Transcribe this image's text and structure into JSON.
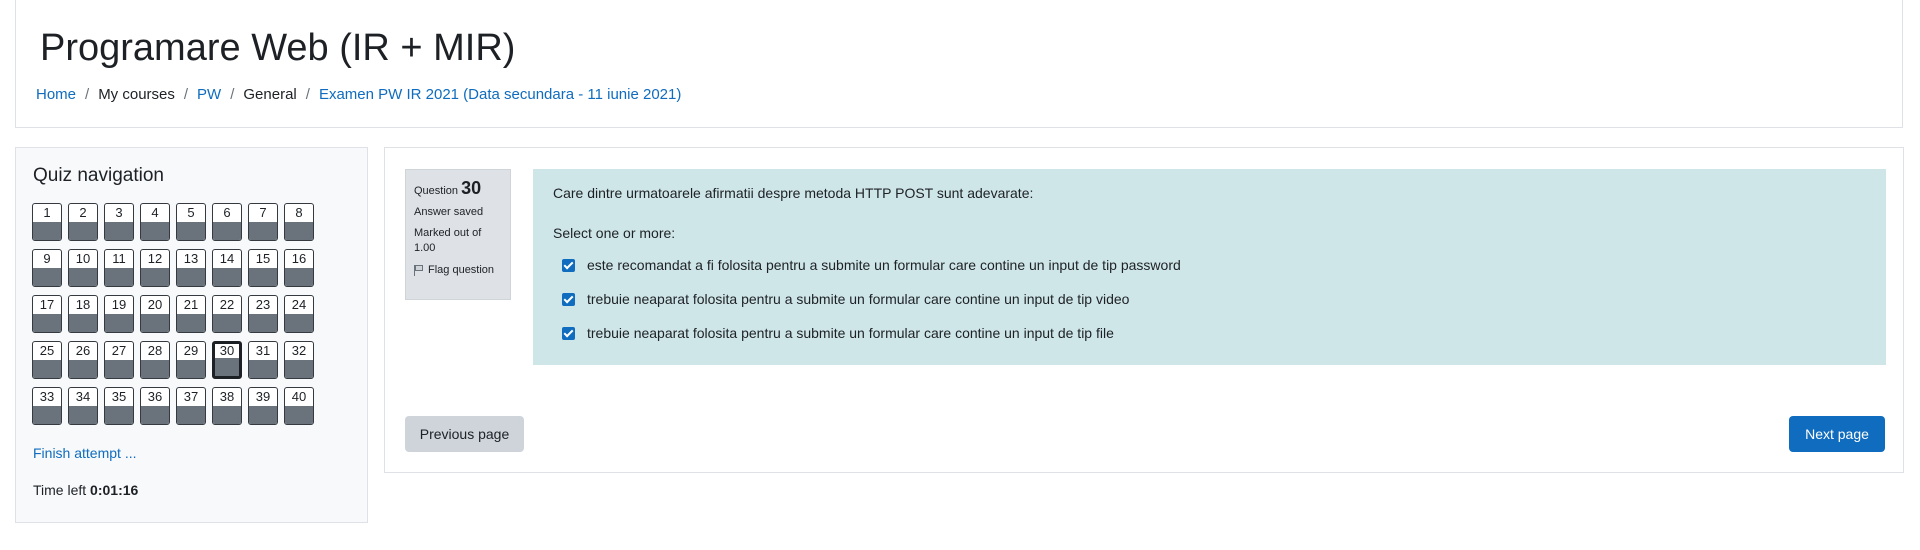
{
  "header": {
    "title": "Programare Web (IR + MIR)",
    "breadcrumb": [
      {
        "label": "Home",
        "link": true
      },
      {
        "label": "My courses",
        "link": false
      },
      {
        "label": "PW",
        "link": true
      },
      {
        "label": "General",
        "link": false
      },
      {
        "label": "Examen PW IR 2021 (Data secundara - 11 iunie 2021)",
        "link": true
      }
    ],
    "separator": "/"
  },
  "quiz_nav": {
    "title": "Quiz navigation",
    "questions": [
      "1",
      "2",
      "3",
      "4",
      "5",
      "6",
      "7",
      "8",
      "9",
      "10",
      "11",
      "12",
      "13",
      "14",
      "15",
      "16",
      "17",
      "18",
      "19",
      "20",
      "21",
      "22",
      "23",
      "24",
      "25",
      "26",
      "27",
      "28",
      "29",
      "30",
      "31",
      "32",
      "33",
      "34",
      "35",
      "36",
      "37",
      "38",
      "39",
      "40"
    ],
    "current": "30",
    "finish_label": "Finish attempt ...",
    "time_left_label": "Time left",
    "time_left_value": "0:01:16"
  },
  "question": {
    "label": "Question",
    "number": "30",
    "state": "Answer saved",
    "marked_out_of": "Marked out of",
    "max_mark": "1.00",
    "flag_label": "Flag question",
    "text": "Care dintre urmatoarele afirmatii despre metoda HTTP POST sunt adevarate:",
    "prompt": "Select one or more:",
    "options": [
      {
        "label": "este recomandat a fi folosita pentru a submite un formular care contine un input de tip password",
        "checked": true
      },
      {
        "label": "trebuie neaparat folosita pentru a submite un formular care contine un input de tip video",
        "checked": true
      },
      {
        "label": "trebuie neaparat folosita pentru a submite un formular care contine un input de tip file",
        "checked": true
      }
    ]
  },
  "navigation": {
    "previous_label": "Previous page",
    "next_label": "Next page"
  },
  "colors": {
    "link": "#0f6cbf",
    "formulation_bg": "#cfe6e9",
    "primary_button": "#0f6cbf",
    "secondary_button": "#ced4da",
    "nav_state": "#6a737b"
  }
}
